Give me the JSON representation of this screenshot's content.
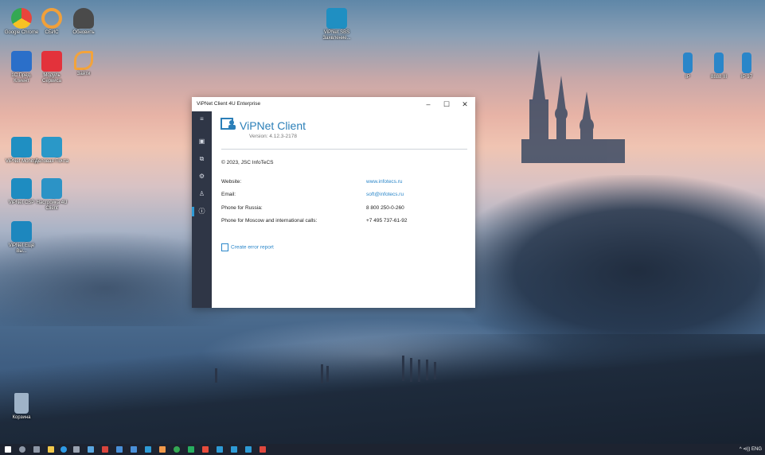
{
  "desktop_icons": [
    {
      "name": "Google Chrome",
      "color": "#e8453c"
    },
    {
      "name": "СБИС",
      "color": "#f1a03a"
    },
    {
      "name": "Обновить",
      "color": "#4a4a4a"
    },
    {
      "name": "1С:Пред. Клиент",
      "color": "#2b6fc9"
    },
    {
      "name": "Модуль Сервиса",
      "color": "#e3323b"
    },
    {
      "name": "Зайти",
      "color": "#f3a33b"
    },
    {
      "name": "ViPNet Monitor",
      "color": "#1f8fc2"
    },
    {
      "name": "Деловая Почта",
      "color": "#2a98c8"
    },
    {
      "name": "ViPNet CSP",
      "color": "#1e8cc1"
    },
    {
      "name": "Настройка 4U Client",
      "color": "#2c93c6"
    },
    {
      "name": "ViPNet Ещё Вы...",
      "color": "#1d87be"
    },
    {
      "name": "ViPNet SBS Заявление...",
      "color": "#1f8fc2"
    },
    {
      "name": "IP",
      "color": "#2a86c9"
    },
    {
      "name": "8888 III",
      "color": "#2a86c9"
    },
    {
      "name": "IP 97",
      "color": "#2a86c9"
    },
    {
      "name": "Корзина",
      "color": "#9fb3c8"
    }
  ],
  "window": {
    "title": "ViPNet Client 4U Enterprise",
    "minimize": "–",
    "maximize": "☐",
    "close": "✕",
    "app_name": "ViPNet Client",
    "version": "Version: 4.12.3-2178",
    "copyright": "© 2023, JSC InfoTeCS",
    "website_label": "Website:",
    "website_value": "www.infotecs.ru",
    "email_label": "Email:",
    "email_value": "soft@infotecs.ru",
    "phone_russia_label": "Phone for Russia:",
    "phone_russia_value": "8 800 250-0-260",
    "phone_moscow_label": "Phone for Moscow and international calls:",
    "phone_moscow_value": "+7 495 737-61-92",
    "error_report": "Create error report"
  },
  "sidebar_icons": [
    "menu-icon",
    "dashboard-icon",
    "network-icon",
    "settings-icon",
    "user-icon",
    "info-icon"
  ],
  "tray": {
    "text": "^ ⊲)) ENG"
  },
  "colors": {
    "accent": "#2b7fb8",
    "sidebar": "#2f3646",
    "link": "#2a86c9"
  }
}
